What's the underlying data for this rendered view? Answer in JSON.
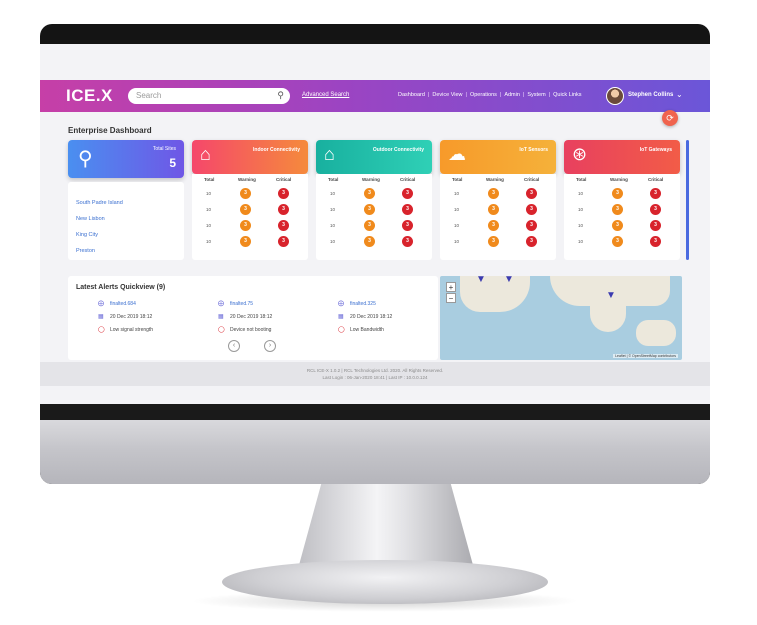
{
  "header": {
    "logo": "ICE.X",
    "search_placeholder": "Search",
    "advanced_search": "Advanced Search",
    "nav": [
      "Dashboard",
      "Device View",
      "Operations",
      "Admin",
      "System",
      "Quick Links"
    ],
    "user_name": "Stephen Collins",
    "brand_gradient": [
      "#c63fa7",
      "#9c44c2",
      "#6b56d8"
    ]
  },
  "dashboard": {
    "title": "Enterprise Dashboard",
    "sites_card": {
      "label": "Total Sites",
      "count": "5",
      "color": "#4a8ff0"
    },
    "sites": [
      "South Padre Island",
      "New Lisbon",
      "King City",
      "Preston"
    ],
    "categories": [
      {
        "label": "Indoor Connectivity",
        "icon": "house-wifi-icon",
        "colors": [
          "#f5476b",
          "#f58a3c"
        ]
      },
      {
        "label": "Outdoor Connectivity",
        "icon": "outdoor-wifi-icon",
        "colors": [
          "#1ab6a3",
          "#2fd0b6"
        ]
      },
      {
        "label": "IoT Sensors",
        "icon": "cloud-sensor-icon",
        "colors": [
          "#f7a12a",
          "#f58a1f"
        ]
      },
      {
        "label": "IoT Gateways",
        "icon": "antenna-icon",
        "colors": [
          "#e8405f",
          "#f25c47"
        ]
      }
    ],
    "columns": [
      "Total",
      "Warning",
      "Critical"
    ],
    "rows": [
      {
        "total": "10",
        "warning": "3",
        "critical": "3"
      },
      {
        "total": "10",
        "warning": "3",
        "critical": "3"
      },
      {
        "total": "10",
        "warning": "3",
        "critical": "3"
      },
      {
        "total": "10",
        "warning": "3",
        "critical": "3"
      }
    ],
    "status_colors": {
      "warning": "#f08a1c",
      "critical": "#d8232c"
    }
  },
  "alerts": {
    "title": "Latest Alerts Quickview (9)",
    "items": [
      {
        "name": "finalted.684",
        "date": "20 Dec 2019 18:12",
        "message": "Low signal strength"
      },
      {
        "name": "finalted.75",
        "date": "20 Dec 2019 18:12",
        "message": "Device not booting"
      },
      {
        "name": "finalted.325",
        "date": "20 Dec 2019 18:12",
        "message": "Low Bandwidth"
      }
    ],
    "prev": "‹",
    "next": "›"
  },
  "map": {
    "zoom_in": "+",
    "zoom_out": "−",
    "attribution": "Leaflet | © OpenStreetMap contributors"
  },
  "footer": {
    "line1": "RCL ICE-X 1.0.2 | RCL Technologies Ltd. 2020. All Rights Reserved.",
    "line2": "Last Login : 06-Jan-2020 18:41 | Last IP : 10.0.0.124"
  }
}
